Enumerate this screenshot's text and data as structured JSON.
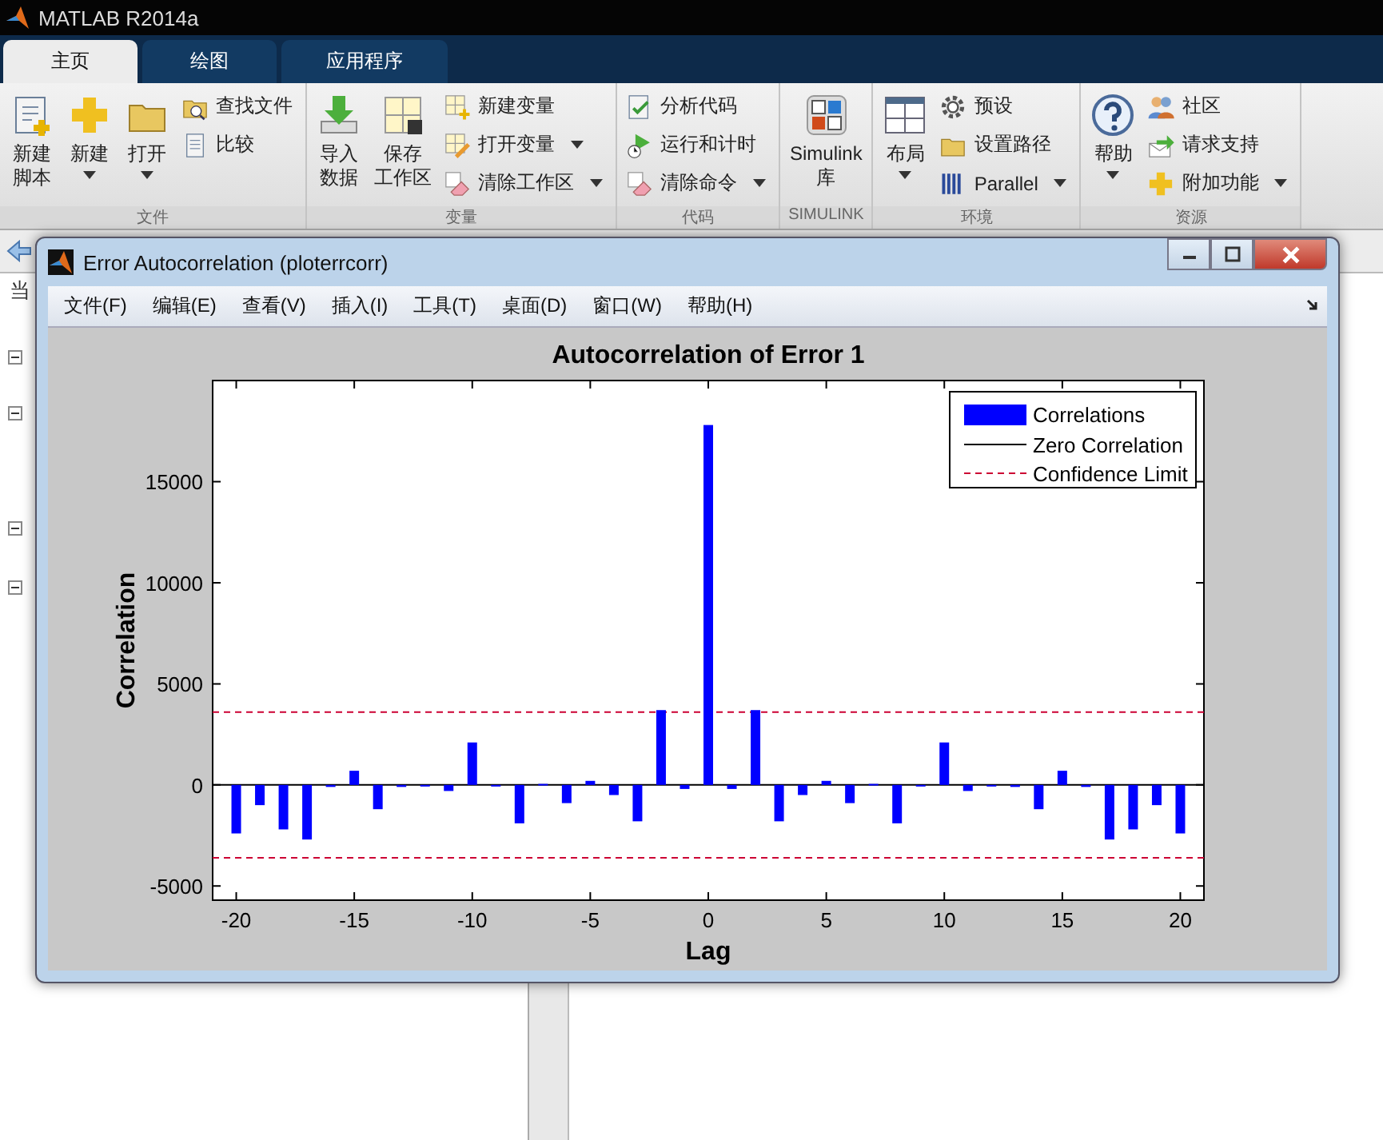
{
  "app": {
    "title": "MATLAB R2014a"
  },
  "tabs": [
    {
      "label": "主页",
      "selected": true
    },
    {
      "label": "绘图",
      "selected": false
    },
    {
      "label": "应用程序",
      "selected": false
    }
  ],
  "ribbon_groups": [
    {
      "label": "文件",
      "columns": [
        {
          "kind": "large",
          "lines": [
            "新建",
            "脚本"
          ],
          "dropdown": false
        },
        {
          "kind": "large",
          "lines": [
            "新建"
          ],
          "dropdown": true
        },
        {
          "kind": "large",
          "lines": [
            "打开"
          ],
          "dropdown": true
        },
        {
          "kind": "stack",
          "items": [
            {
              "label": "查找文件",
              "dropdown": false
            },
            {
              "label": "比较",
              "dropdown": false
            }
          ]
        }
      ]
    },
    {
      "label": "变量",
      "columns": [
        {
          "kind": "large",
          "lines": [
            "导入",
            "数据"
          ],
          "dropdown": false
        },
        {
          "kind": "large",
          "lines": [
            "保存",
            "工作区"
          ],
          "dropdown": false
        },
        {
          "kind": "stack",
          "items": [
            {
              "label": "新建变量",
              "dropdown": false
            },
            {
              "label": "打开变量",
              "dropdown": true
            },
            {
              "label": "清除工作区",
              "dropdown": true
            }
          ]
        }
      ]
    },
    {
      "label": "代码",
      "columns": [
        {
          "kind": "stack",
          "items": [
            {
              "label": "分析代码",
              "dropdown": false
            },
            {
              "label": "运行和计时",
              "dropdown": false
            },
            {
              "label": "清除命令",
              "dropdown": true
            }
          ]
        }
      ]
    },
    {
      "label": "SIMULINK",
      "columns": [
        {
          "kind": "large",
          "lines": [
            "Simulink",
            "库"
          ],
          "dropdown": false
        }
      ]
    },
    {
      "label": "环境",
      "columns": [
        {
          "kind": "large",
          "lines": [
            "布局"
          ],
          "dropdown": true
        },
        {
          "kind": "stack",
          "items": [
            {
              "label": "预设",
              "dropdown": false
            },
            {
              "label": "设置路径",
              "dropdown": false
            },
            {
              "label": "Parallel",
              "dropdown": true
            }
          ]
        }
      ]
    },
    {
      "label": "资源",
      "columns": [
        {
          "kind": "large",
          "lines": [
            "帮助"
          ],
          "dropdown": true
        },
        {
          "kind": "stack",
          "items": [
            {
              "label": "社区",
              "dropdown": false
            },
            {
              "label": "请求支持",
              "dropdown": false
            },
            {
              "label": "附加功能",
              "dropdown": true
            }
          ]
        }
      ]
    }
  ],
  "side_panel": {
    "header": "当"
  },
  "figure_window": {
    "title": "Error Autocorrelation (ploterrcorr)",
    "menu": [
      "文件(F)",
      "编辑(E)",
      "查看(V)",
      "插入(I)",
      "工具(T)",
      "桌面(D)",
      "窗口(W)",
      "帮助(H)"
    ],
    "chart_data": {
      "type": "bar",
      "title": "Autocorrelation of Error 1",
      "xlabel": "Lag",
      "ylabel": "Correlation",
      "x": [
        -20,
        -19,
        -18,
        -17,
        -16,
        -15,
        -14,
        -13,
        -12,
        -11,
        -10,
        -9,
        -8,
        -7,
        -6,
        -5,
        -4,
        -3,
        -2,
        -1,
        0,
        1,
        2,
        3,
        4,
        5,
        6,
        7,
        8,
        9,
        10,
        11,
        12,
        13,
        14,
        15,
        16,
        17,
        18,
        19,
        20
      ],
      "series": [
        {
          "name": "Correlations",
          "color": "#0000ff",
          "values": [
            -2400,
            -1000,
            -2200,
            -2700,
            -100,
            700,
            -1200,
            -100,
            0,
            -300,
            2100,
            0,
            -1900,
            50,
            -900,
            200,
            -500,
            -1800,
            3700,
            -200,
            17800,
            -200,
            3700,
            -1800,
            -500,
            200,
            -900,
            50,
            -1900,
            0,
            2100,
            -300,
            0,
            -100,
            -1200,
            700,
            -100,
            -2700,
            -2200,
            -1000,
            -2400
          ]
        }
      ],
      "ref_lines": [
        {
          "axis": "y",
          "value": 0,
          "label": "Zero Correlation",
          "color": "#000000"
        },
        {
          "axis": "y",
          "value": 3600,
          "label": "Confidence Limit",
          "color": "#cc0033"
        },
        {
          "axis": "y",
          "value": -3600,
          "color": "#cc0033"
        }
      ],
      "legend": "upper right",
      "xlim": [
        -21,
        21
      ],
      "ylim": [
        -5700,
        20000
      ],
      "xticks": [
        -20,
        -15,
        -10,
        -5,
        0,
        5,
        10,
        15,
        20
      ],
      "yticks": [
        -5000,
        0,
        5000,
        10000,
        15000
      ]
    }
  }
}
